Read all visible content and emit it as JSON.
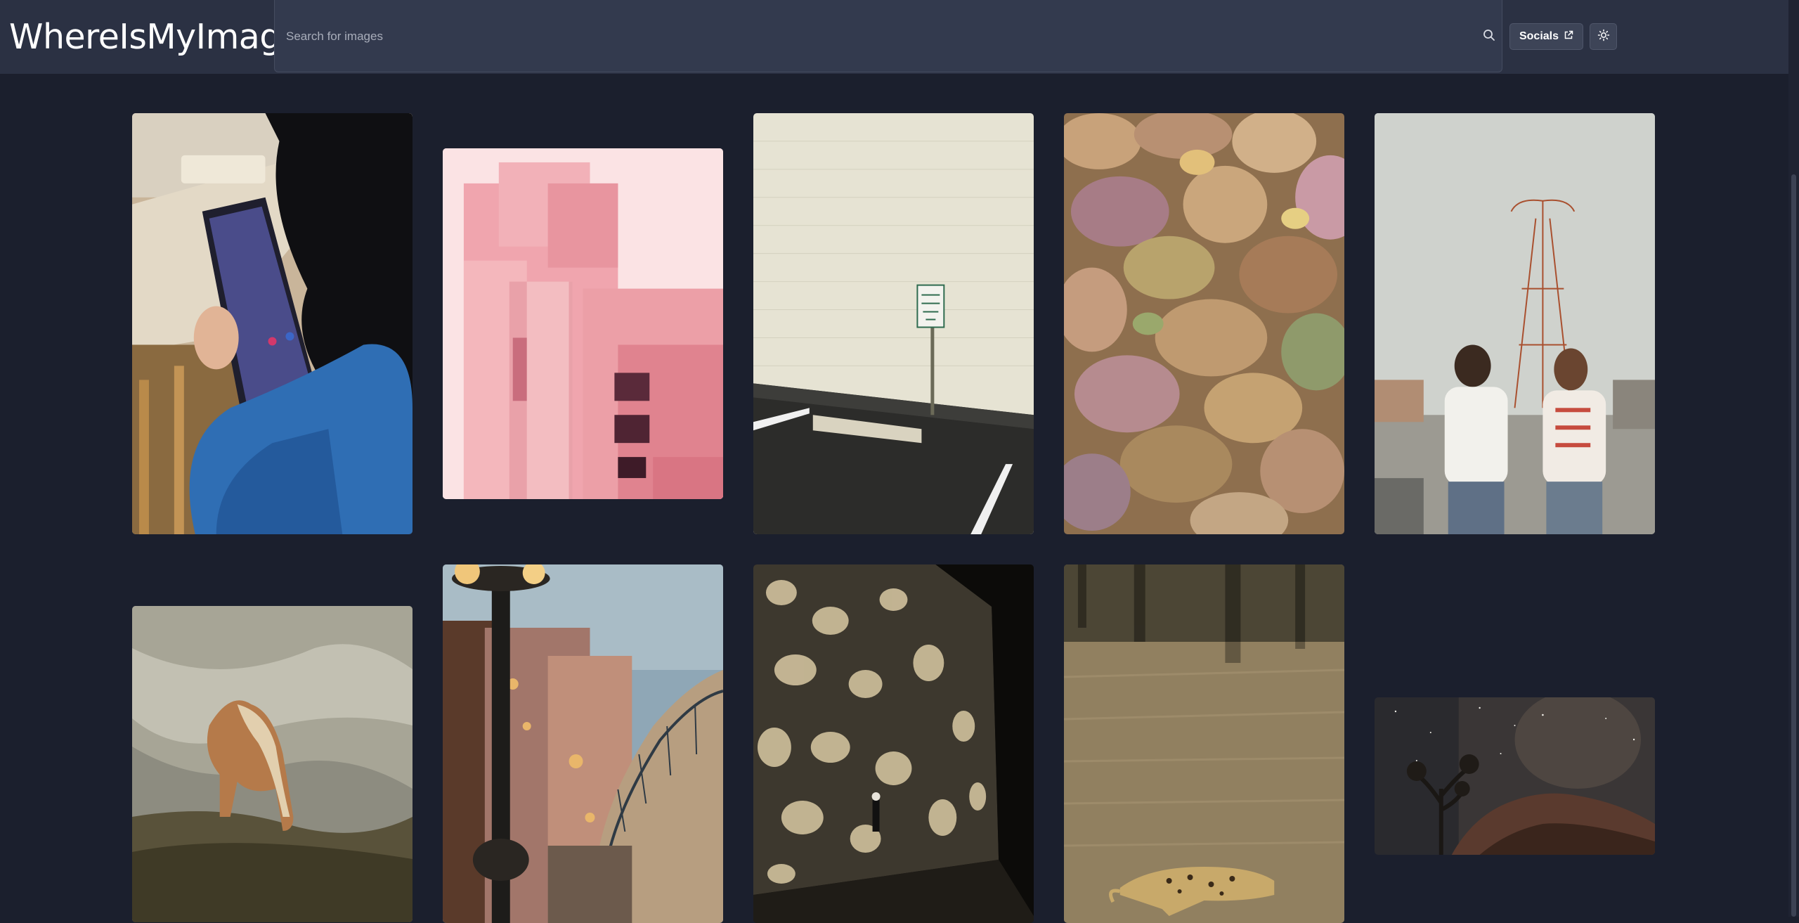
{
  "app": {
    "title": "WhereIsMyImage"
  },
  "search": {
    "placeholder": "Search for images",
    "value": ""
  },
  "header": {
    "socials_label": "Socials"
  },
  "icons": {
    "search": "search-icon",
    "external_link": "external-link-icon",
    "theme": "sun-icon"
  },
  "colors": {
    "background": "#1b1f2d",
    "header": "#2b3143",
    "search": "#333a4e",
    "button": "#3d4457"
  }
}
